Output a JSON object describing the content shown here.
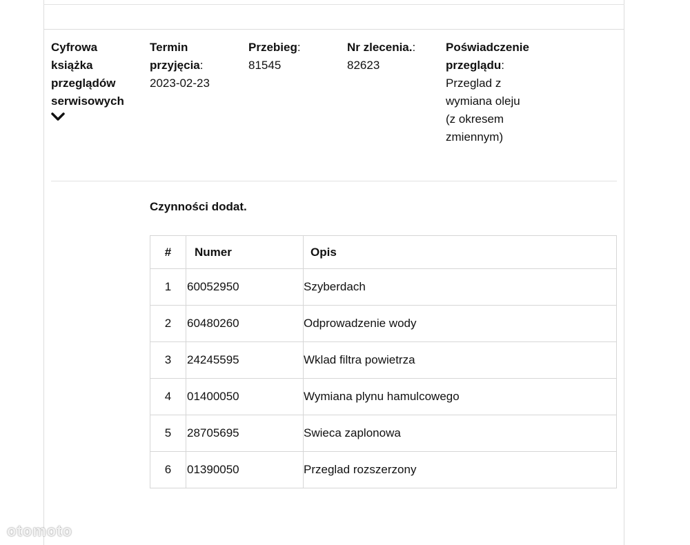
{
  "header": {
    "book": {
      "label": "Cyfrowa książka przeglądów serwisowych"
    },
    "date": {
      "label": "Termin przyjęcia",
      "value": "2023-02-23"
    },
    "mileage": {
      "label": "Przebieg",
      "value": "81545"
    },
    "order": {
      "label": "Nr zlecenia.",
      "value": "82623"
    },
    "certificate": {
      "label": "Poświadczenie przeglądu",
      "value": "Przeglad z wymiana oleju (z okresem zmiennym)"
    }
  },
  "section": {
    "title": "Czynności dodat."
  },
  "table": {
    "columns": [
      "#",
      "Numer",
      "Opis"
    ],
    "rows": [
      {
        "idx": "1",
        "numer": "60052950",
        "opis": "Szyberdach"
      },
      {
        "idx": "2",
        "numer": "60480260",
        "opis": "Odprowadzenie wody"
      },
      {
        "idx": "3",
        "numer": "24245595",
        "opis": "Wklad filtra powietrza"
      },
      {
        "idx": "4",
        "numer": "01400050",
        "opis": "Wymiana plynu hamulcowego"
      },
      {
        "idx": "5",
        "numer": "28705695",
        "opis": "Swieca zaplonowa"
      },
      {
        "idx": "6",
        "numer": "01390050",
        "opis": "Przeglad rozszerzony"
      }
    ]
  },
  "watermark": {
    "text": "otomoto"
  },
  "icons": {
    "expand": "chevron-down-icon"
  }
}
